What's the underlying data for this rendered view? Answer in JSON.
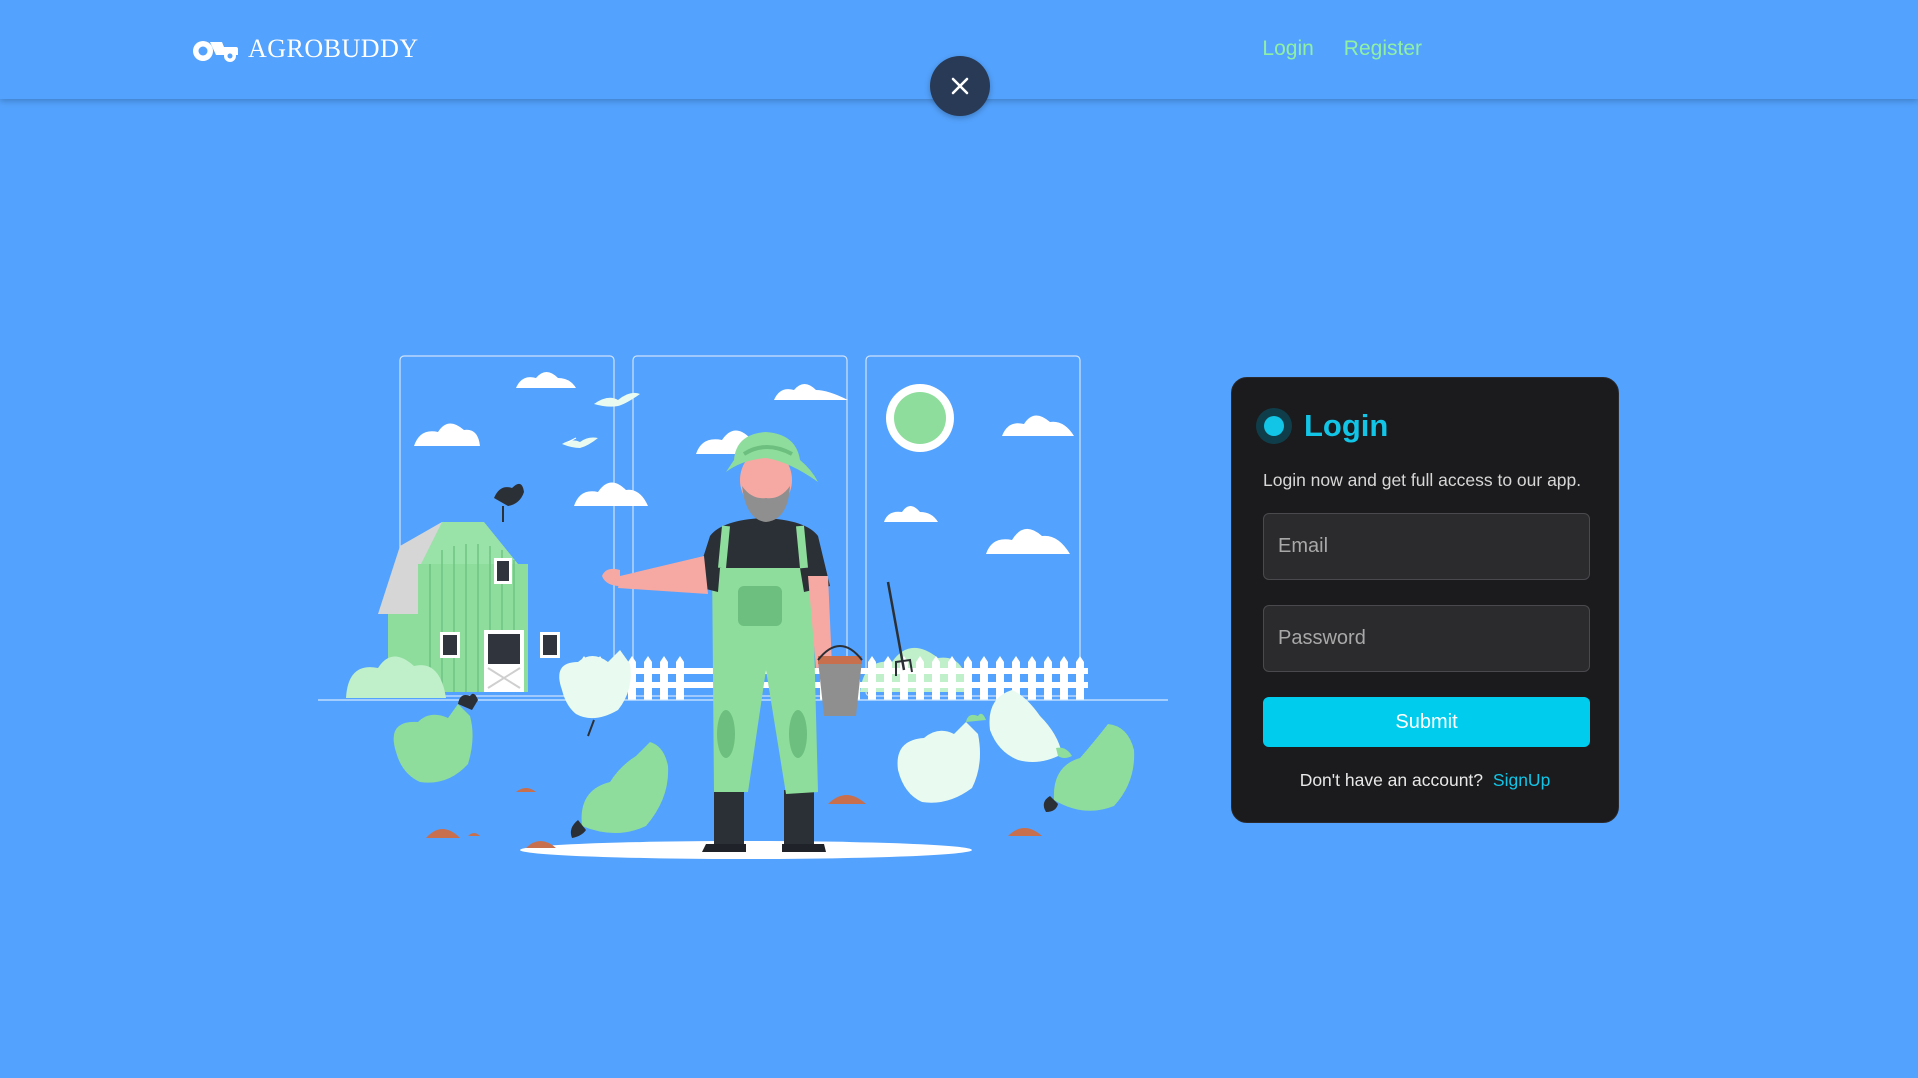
{
  "navbar": {
    "brand": "AGROBUDDY",
    "links": [
      {
        "label": "Login"
      },
      {
        "label": "Register"
      }
    ]
  },
  "close_icon": "close-icon",
  "login": {
    "title": "Login",
    "subtitle": "Login now and get full access to our app.",
    "email_placeholder": "Email",
    "password_placeholder": "Password",
    "submit_label": "Submit",
    "signup_prompt": "Don't have an account?",
    "signup_link": "SignUp"
  },
  "colors": {
    "background": "#53a2fd",
    "nav_link": "#8ff0a4",
    "accent": "#12c4e6",
    "card": "#1b1b1d",
    "close_button": "#283a55"
  }
}
